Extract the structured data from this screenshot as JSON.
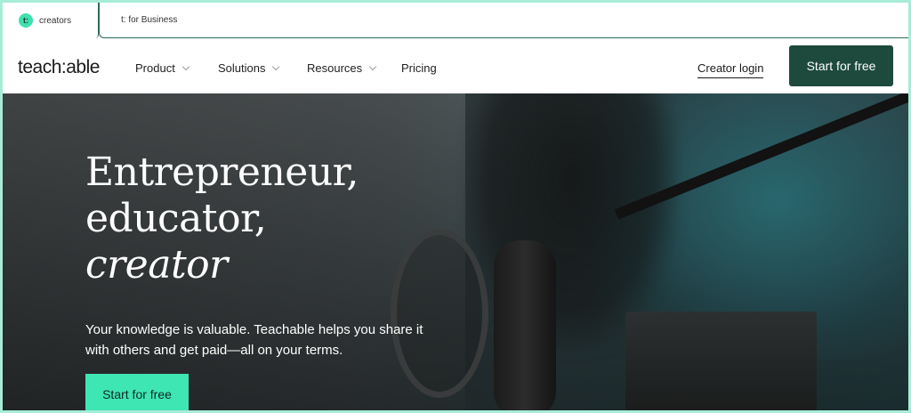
{
  "tabs": {
    "creators": {
      "badge": "t:",
      "label": "creators"
    },
    "business": {
      "label": "t: for Business"
    }
  },
  "nav": {
    "brand": "teach:able",
    "items": [
      {
        "label": "Product"
      },
      {
        "label": "Solutions"
      },
      {
        "label": "Resources"
      },
      {
        "label": "Pricing"
      }
    ],
    "login": "Creator login",
    "cta": "Start for free"
  },
  "hero": {
    "headline_line1": "Entrepreneur,",
    "headline_line2": "educator,",
    "headline_line3": "creator",
    "subtitle": "Your knowledge is valuable. Teachable helps you share it with others and get paid—all on your terms.",
    "cta": "Start for free"
  },
  "colors": {
    "accent": "#3ee6b4",
    "primary_dark": "#1d4a3d",
    "page_border": "#a8ecd8"
  }
}
